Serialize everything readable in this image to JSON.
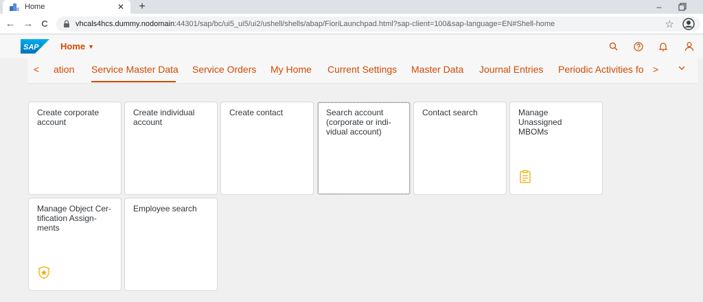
{
  "browser": {
    "tab_title": "Home",
    "tab_close": "✕",
    "new_tab": "+",
    "minimize": "–",
    "url_host": "vhcals4hcs.dummy.nodomain",
    "url_rest": ":44301/sap/bc/ui5_ui5/ui2/ushell/shells/abap/FioriLaunchpad.html?sap-client=100&sap-language=EN#Shell-home",
    "back": "←",
    "forward": "→",
    "reload": "C",
    "star": "☆"
  },
  "shell": {
    "logo_text": "SAP",
    "home_label": "Home",
    "caret": "▼"
  },
  "anchor_nav": {
    "prev_arrow": "<",
    "next_arrow": ">",
    "items": [
      "ation",
      "Service Master Data",
      "Service Orders",
      "My Home",
      "Current Settings",
      "Master Data",
      "Journal Entries",
      "Periodic Activities fo"
    ],
    "selected_index": 1
  },
  "tiles": [
    {
      "title": "Create corporate account",
      "icon": ""
    },
    {
      "title": "Create individual account",
      "icon": ""
    },
    {
      "title": "Create contact",
      "icon": ""
    },
    {
      "title": "Search account (corporate or indi-vidual account)",
      "icon": ""
    },
    {
      "title": "Contact search",
      "icon": ""
    },
    {
      "title": "Manage Unassigned MBOMs",
      "icon": "checklist-icon"
    },
    {
      "title": "Manage Object Cer-tification Assign-ments",
      "icon": "badge-icon"
    },
    {
      "title": "Employee search",
      "icon": ""
    }
  ],
  "colors": {
    "accent": "#d14900",
    "tile_icon": "#f0ab00",
    "sap_blue": "#0a6ed1"
  }
}
